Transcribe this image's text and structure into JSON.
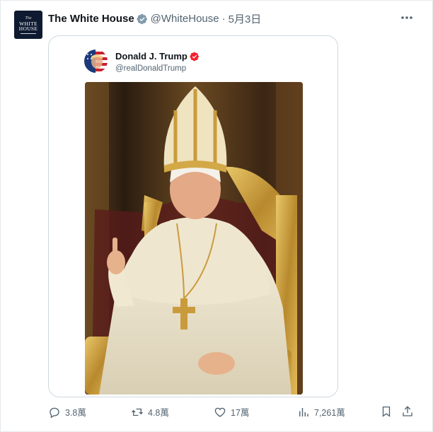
{
  "post": {
    "author": {
      "display_name": "The White House",
      "handle": "@WhiteHouse",
      "avatar": {
        "line1": "The",
        "line2": "WHITE",
        "line3": "HOUSE"
      }
    },
    "separator": "·",
    "date": "5月3日",
    "more_icon": "more-horizontal-icon"
  },
  "quoted": {
    "display_name": "Donald J. Trump",
    "handle": "@realDonaldTrump",
    "image_alt": "Photo of a man dressed in white papal vestments and gold mitre seated on a gilded throne"
  },
  "actions": {
    "replies": "3.8萬",
    "reposts": "4.8萬",
    "likes": "17萬",
    "views": "7,261萬"
  },
  "colors": {
    "verified_blue": "#1d9bf0",
    "verified_red": "#f4212e",
    "text_secondary": "#536471",
    "icon": "#536471"
  }
}
